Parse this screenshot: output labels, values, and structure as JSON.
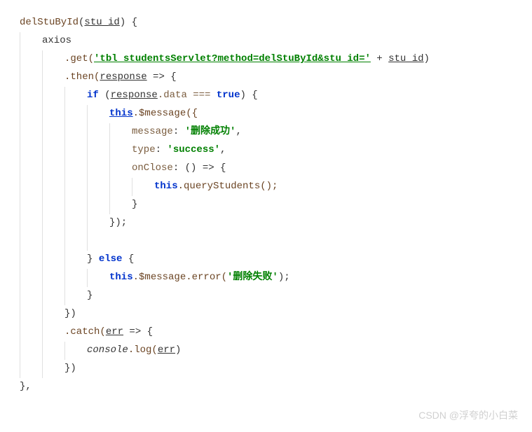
{
  "code": {
    "l1_method": "delStuById",
    "l1_param": "stu_id",
    "l1_rest": ") {",
    "l2": "axios",
    "l3_dot_get": ".get(",
    "l3_str": "'tbl_studentsServlet?method=delStuById&stu_id='",
    "l3_plus": " + ",
    "l3_param": "stu_id",
    "l3_close": ")",
    "l4_then": ".then(",
    "l4_param": "response",
    "l4_arrow": " => {",
    "l5_if": "if",
    "l5_open": " (",
    "l5_resp": "response",
    "l5_data": ".data === ",
    "l5_true": "true",
    "l5_close": ") {",
    "l6_this": "this",
    "l6_msg": ".$message({",
    "l7_key": "message",
    "l7_colon": ": ",
    "l7_val": "'删除成功'",
    "l7_comma": ",",
    "l8_key": "type",
    "l8_colon": ": ",
    "l8_val": "'success'",
    "l8_comma": ",",
    "l9_key": "onClose",
    "l9_rest": ": () => {",
    "l10_this": "this",
    "l10_call": ".queryStudents();",
    "l11": "}",
    "l12": "});",
    "l14_else": "} ",
    "l14_else_kw": "else",
    "l14_brace": " {",
    "l15_this": "this",
    "l15_msg": ".$message.error(",
    "l15_str": "'删除失败'",
    "l15_close": ");",
    "l16": "}",
    "l17": "})",
    "l18_catch": ".catch(",
    "l18_param": "err",
    "l18_arrow": " => {",
    "l19_console": "console",
    "l19_log": ".log(",
    "l19_param": "err",
    "l19_close": ")",
    "l20": "})",
    "l21": "},"
  },
  "watermark": "CSDN @浮夸的小白菜"
}
